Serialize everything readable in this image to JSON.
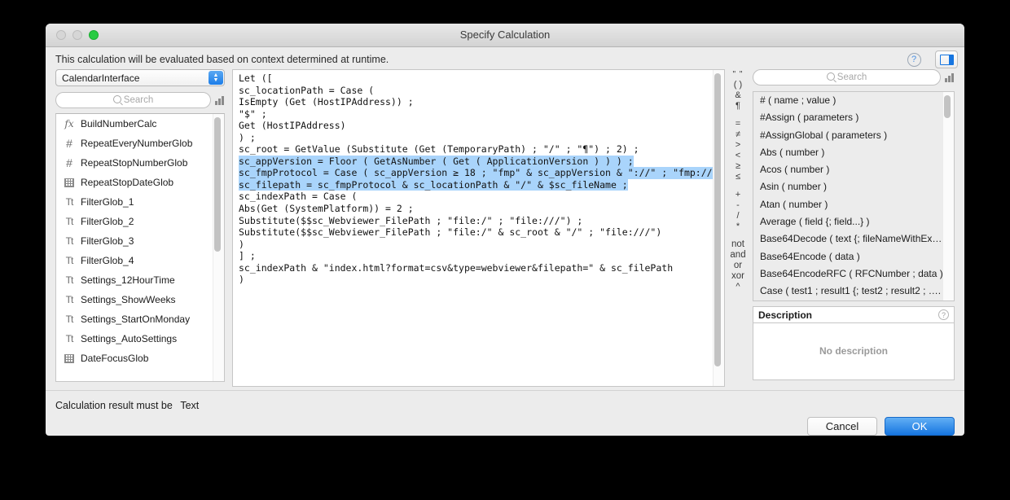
{
  "window": {
    "title": "Specify Calculation",
    "hint": "This calculation will be evaluated based on context determined at runtime.",
    "help_label": "?",
    "accent": "#1675e0",
    "selection_color": "#a9d4fb"
  },
  "left": {
    "context_select": "CalendarInterface",
    "search_placeholder": "Search",
    "fields": [
      {
        "icon": "fx-icon",
        "label": "BuildNumberCalc"
      },
      {
        "icon": "number-icon",
        "label": "RepeatEveryNumberGlob"
      },
      {
        "icon": "number-icon",
        "label": "RepeatStopNumberGlob"
      },
      {
        "icon": "calendar-icon",
        "label": "RepeatStopDateGlob"
      },
      {
        "icon": "text-icon",
        "label": "FilterGlob_1"
      },
      {
        "icon": "text-icon",
        "label": "FilterGlob_2"
      },
      {
        "icon": "text-icon",
        "label": "FilterGlob_3"
      },
      {
        "icon": "text-icon",
        "label": "FilterGlob_4"
      },
      {
        "icon": "text-icon",
        "label": "Settings_12HourTime"
      },
      {
        "icon": "text-icon",
        "label": "Settings_ShowWeeks"
      },
      {
        "icon": "text-icon",
        "label": "Settings_StartOnMonday"
      },
      {
        "icon": "text-icon",
        "label": "Settings_AutoSettings"
      },
      {
        "icon": "calendar-icon",
        "label": "DateFocusGlob"
      }
    ]
  },
  "editor": {
    "lines_before": [
      "Let ([",
      "sc_locationPath = Case (",
      "IsEmpty (Get (HostIPAddress)) ;",
      "\"$\" ;",
      "Get (HostIPAddress)",
      ") ;",
      "sc_root = GetValue (Substitute (Get (TemporaryPath) ; \"/\" ; \"¶\") ; 2) ;"
    ],
    "lines_selected": [
      "sc_appVersion = Floor ( GetAsNumber ( Get ( ApplicationVersion ) ) ) ;",
      "sc_fmpProtocol = Case ( sc_appVersion ≥ 18 ; \"fmp\" & sc_appVersion & \"://\" ; \"fmp://\" ) ;",
      "sc_filepath = sc_fmpProtocol & sc_locationPath & \"/\" & $sc_fileName ;"
    ],
    "lines_after": [
      "sc_indexPath = Case (",
      "Abs(Get (SystemPlatform)) = 2 ;",
      "Substitute($$sc_Webviewer_FilePath ; \"file:/\" ; \"file:///\") ;",
      "Substitute($$sc_Webviewer_FilePath ; \"file:/\" & sc_root & \"/\" ; \"file:///\")",
      ")",
      "] ;",
      "sc_indexPath & \"index.html?format=csv&type=webviewer&filepath=\" & sc_filePath",
      ")"
    ]
  },
  "operators": {
    "groups": [
      [
        "\" \"",
        "( )",
        "&",
        "¶"
      ],
      [
        "=",
        "≠",
        ">",
        "<",
        "≥",
        "≤"
      ],
      [
        "+",
        "-",
        "/",
        "*"
      ],
      [
        "not",
        "and",
        "or",
        "xor",
        "^"
      ]
    ]
  },
  "right": {
    "search_placeholder": "Search",
    "functions": [
      "# ( name ; value )",
      "#Assign ( parameters )",
      "#AssignGlobal ( parameters )",
      "Abs ( number )",
      "Acos ( number )",
      "Asin ( number )",
      "Atan ( number )",
      "Average ( field {; field...} )",
      "Base64Decode ( text {; fileNameWithEx…",
      "Base64Encode ( data )",
      "Base64EncodeRFC ( RFCNumber ; data )",
      "Case ( test1 ; result1 {; test2 ; result2 ; …."
    ],
    "description_title": "Description",
    "description_body": "No description",
    "description_help": "?"
  },
  "footer": {
    "result_label": "Calculation result must be",
    "result_type": "Text",
    "cancel_label": "Cancel",
    "ok_label": "OK"
  }
}
